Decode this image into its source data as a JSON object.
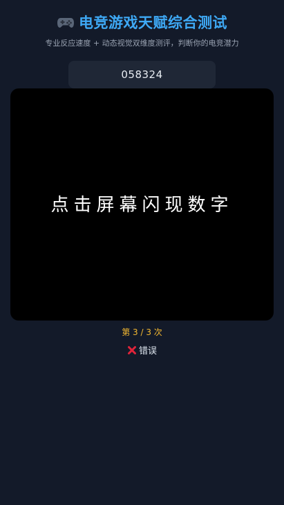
{
  "header": {
    "icon": "gamepad-icon",
    "title": "电竞游戏天赋综合测试",
    "subtitle": "专业反应速度 + 动态视觉双维度测评，判断你的电竞潜力"
  },
  "input_display": {
    "value": "058324"
  },
  "flash_area": {
    "prompt": "点击屏幕闪现数字"
  },
  "round": {
    "label": "第 3 / 3 次"
  },
  "result": {
    "icon": "cross-icon",
    "label": "错误"
  },
  "colors": {
    "background": "#131a29",
    "title": "#3ea9f5",
    "round": "#f5b931",
    "error": "#e0243a"
  }
}
